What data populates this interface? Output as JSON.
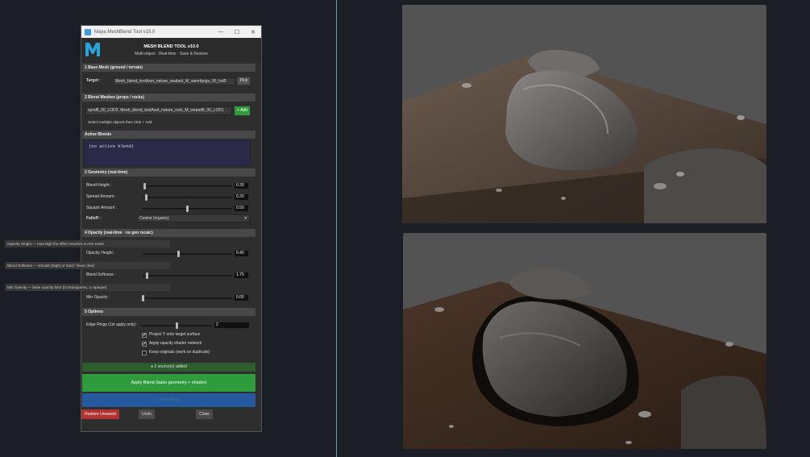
{
  "window": {
    "title": "Maya MeshBlend Tool v10.0",
    "minimize": "—",
    "maximize": "☐",
    "close": "✕"
  },
  "header": {
    "logo_letter": "M",
    "title": "MESH BLEND TOOL  v10.0",
    "subtitle": "Multi-object  ·  Real-time  ·  Save & Restore"
  },
  "section1": {
    "title": "1   Base Mesh  (ground / terrain)",
    "target_label": "Target :",
    "target_value": "Mesh_blend_testAset_nature_seabed_M_weorfgvga_00_lod0",
    "pick_label": "Pick"
  },
  "section2": {
    "title": "2   Blend Meshes  (props / rocks)",
    "field_value": "xpodfl_00_LOD2, Mesh_blend_testAset_nature_rock_M_wepodfl_00_LOD1",
    "add_label": "+ Add",
    "hint": "Select multiple objects then click + Add"
  },
  "active": {
    "title": "Active Blends",
    "content": "(no active blend)"
  },
  "section3": {
    "title": "3   Geometry  (real-time)",
    "blend_height": {
      "label": "Blend Height :",
      "value": "0.30",
      "fraction": 0.02
    },
    "spread": {
      "label": "Spread Amount :",
      "value": "0.20",
      "fraction": 0.04
    },
    "squash": {
      "label": "Squash Amount :",
      "value": "0.50",
      "fraction": 0.5
    },
    "falloff_label": "Falloff :",
    "falloff_value": "Cosine  (organic)"
  },
  "section4": {
    "title": "4   Opacity  (real-time · no geo recalc)",
    "opacity_hint": "Opacity Height — how high the effect reaches on the mesh",
    "opacity_height": {
      "label": "Opacity Height :",
      "value": "0.40",
      "fraction": 0.4
    },
    "softness_hint": "Blend Softness — smooth (high) or hard / linear (low)",
    "softness": {
      "label": "Blend Softness :",
      "value": "1.75",
      "fraction": 0.05
    },
    "min_hint": "Min Opacity — base opacity floor (0=transparent, 1=opaque)",
    "min_opacity": {
      "label": "Min Opacity :",
      "value": "0.00",
      "fraction": 0.0
    }
  },
  "section5": {
    "title": "5   Options",
    "edge_label": "Edge Rings (1st apply only) :",
    "edge_value": "2",
    "edge_fraction": 0.5,
    "options": [
      {
        "label": "Project Y onto target surface",
        "checked": true
      },
      {
        "label": "Apply opacity shader network",
        "checked": true
      },
      {
        "label": "Keep originals (work on duplicate)",
        "checked": false
      }
    ]
  },
  "status": "●  2 source(s) added",
  "buttons": {
    "apply": "Apply Blend   (bake geometry + shader)",
    "save": "Save Blend",
    "restore": "Restore Unsaved",
    "undo": "Undo",
    "close": "Close"
  },
  "colors": {
    "accent_green": "#2e9b3c",
    "accent_blue": "#265a9e",
    "accent_red": "#b23232",
    "active_bg": "#2a2947"
  }
}
